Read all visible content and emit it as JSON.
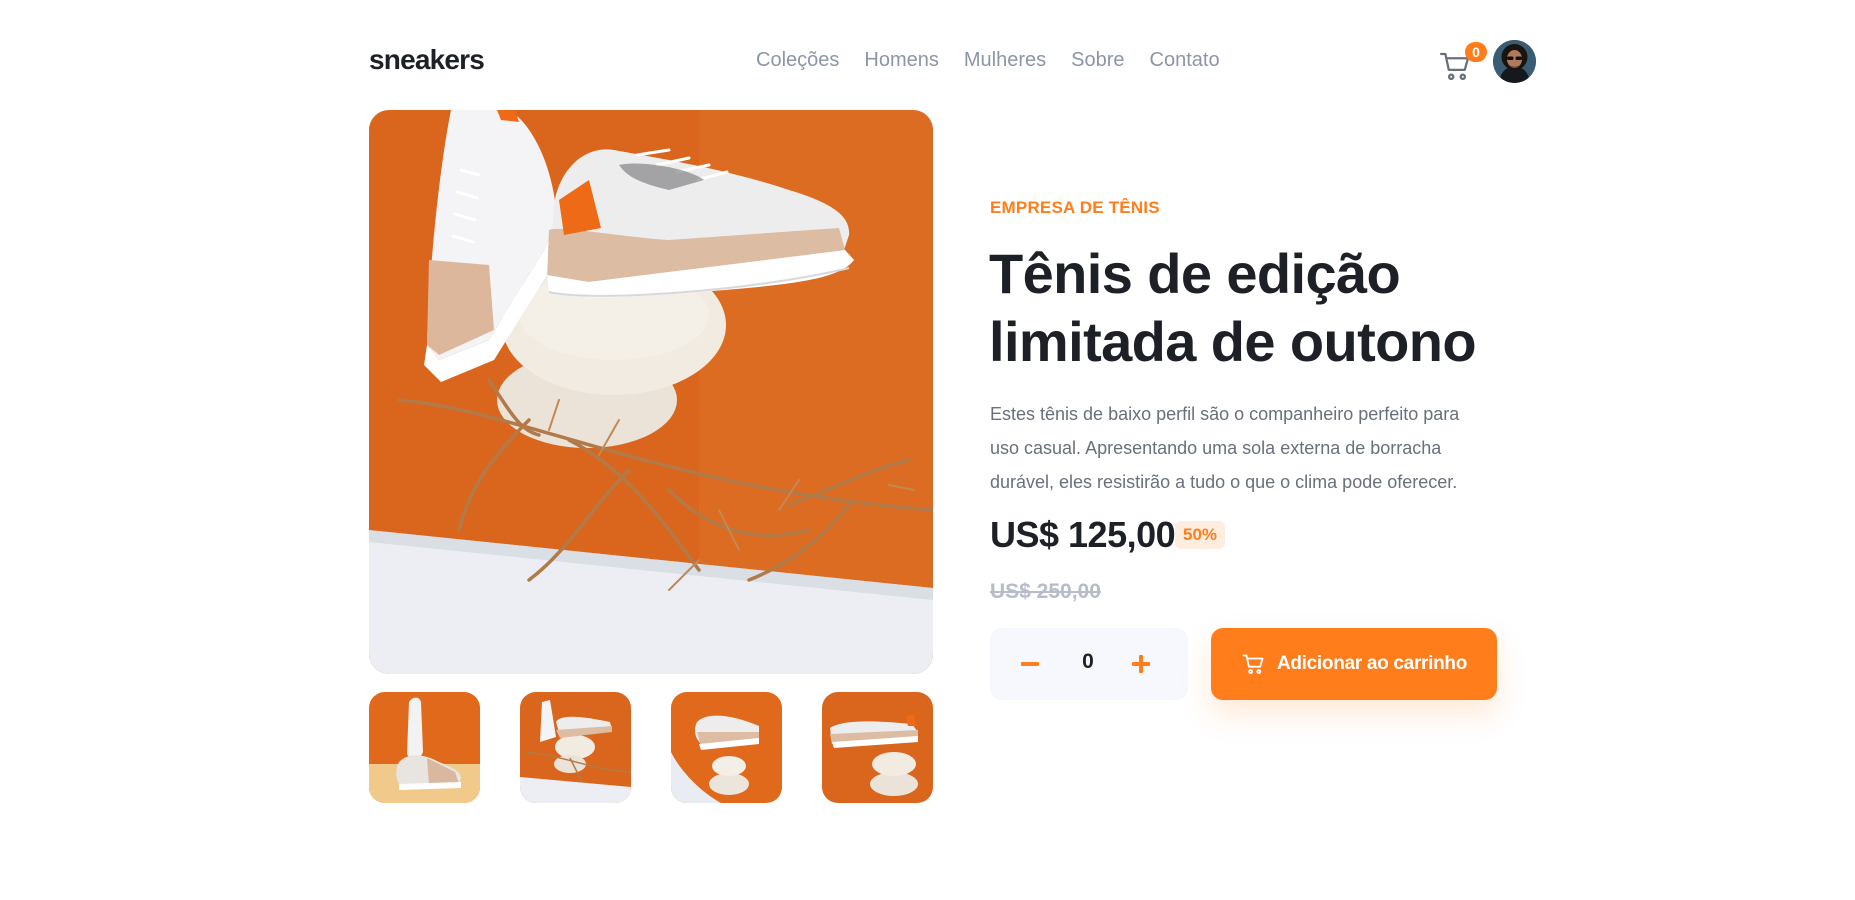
{
  "header": {
    "logo": "sneakers",
    "nav": [
      "Coleções",
      "Homens",
      "Mulheres",
      "Sobre",
      "Contato"
    ],
    "cart_count": "0"
  },
  "product": {
    "company": "EMPRESA DE TÊNIS",
    "title_line1": "Tênis de edição",
    "title_line2": "limitada de outono",
    "description": "Estes tênis de baixo perfil são o companheiro perfeito para uso casual. Apresentando uma sola externa de borracha durável, eles resistirão a tudo o que o clima pode oferecer.",
    "price": "US$ 125,00",
    "discount": "50%",
    "old_price": "US$ 250,00",
    "quantity": "0",
    "add_to_cart": "Adicionar ao carrinho"
  },
  "colors": {
    "accent": "#ff7e1b",
    "accent_soft": "#ffede0",
    "text_dark": "#1d2026",
    "text_muted": "#68707d",
    "nav_text": "#8b96a9",
    "qty_bg": "#f6f8fd"
  },
  "icons": {
    "cart": "cart-icon",
    "minus": "minus-icon",
    "plus": "plus-icon"
  }
}
